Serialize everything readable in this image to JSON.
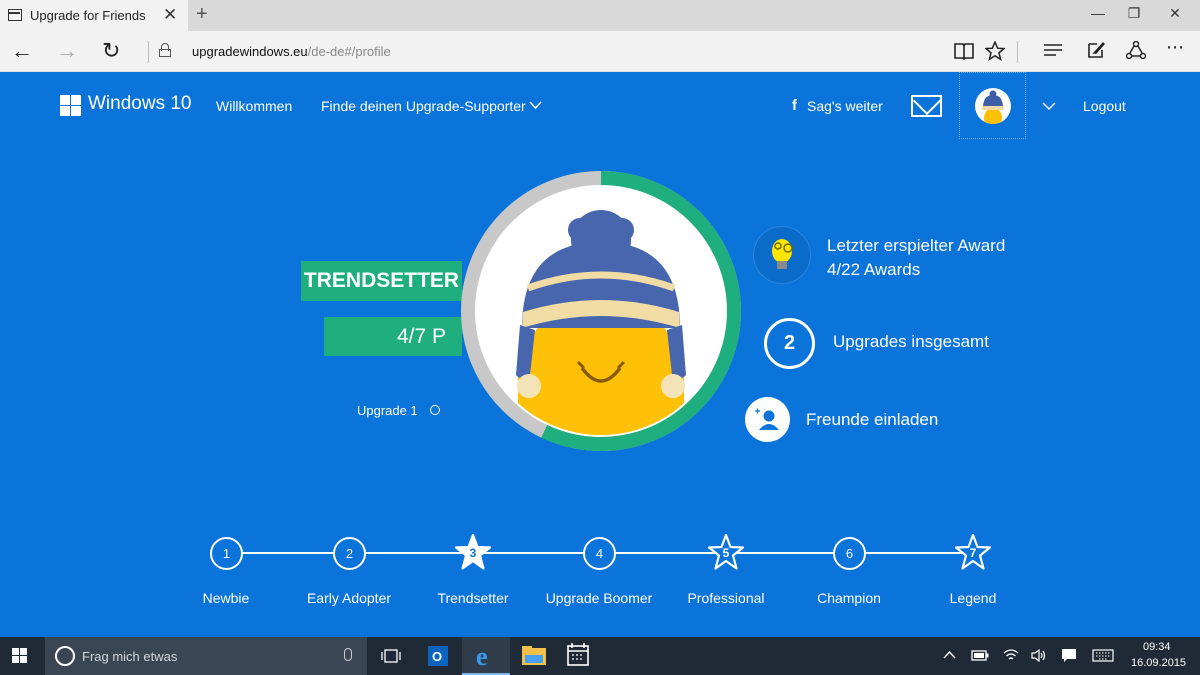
{
  "browser": {
    "tab_title": "Upgrade for Friends",
    "tab_close": "✕",
    "new_tab": "+",
    "url_host": "upgradewindows.eu",
    "url_path": "/de-de#/profile",
    "window_minimize": "—",
    "window_restore": "❐",
    "window_close": "✕",
    "back": "←",
    "forward": "→",
    "refresh": "↻",
    "more": "⋯"
  },
  "site": {
    "logo_text": "Windows 10",
    "nav_welcome": "Willkommen",
    "nav_find": "Finde deinen Upgrade-Supporter",
    "share_icon": "f",
    "share_label": "Sag's weiter",
    "logout": "Logout",
    "accent": "#0a74da",
    "green": "#1fae7e"
  },
  "profile": {
    "rank": "TRENDSETTER",
    "points": "4/7 P",
    "upgrade_label": "Upgrade 1",
    "progress_fraction": 0.57,
    "award_line1": "Letzter erspielter Award",
    "award_line2": "4/22 Awards",
    "upgrades_count": "2",
    "upgrades_label": "Upgrades insgesamt",
    "invite_label": "Freunde einladen"
  },
  "levels": [
    {
      "num": "1",
      "label": "Newbie",
      "shape": "circle"
    },
    {
      "num": "2",
      "label": "Early Adopter",
      "shape": "circle"
    },
    {
      "num": "3",
      "label": "Trendsetter",
      "shape": "star-filled"
    },
    {
      "num": "4",
      "label": "Upgrade Boomer",
      "shape": "circle"
    },
    {
      "num": "5",
      "label": "Professional",
      "shape": "star-outline"
    },
    {
      "num": "6",
      "label": "Champion",
      "shape": "circle"
    },
    {
      "num": "7",
      "label": "Legend",
      "shape": "star-outline"
    }
  ],
  "taskbar": {
    "search_placeholder": "Frag mich etwas",
    "time": "09:34",
    "date": "16.09.2015"
  }
}
